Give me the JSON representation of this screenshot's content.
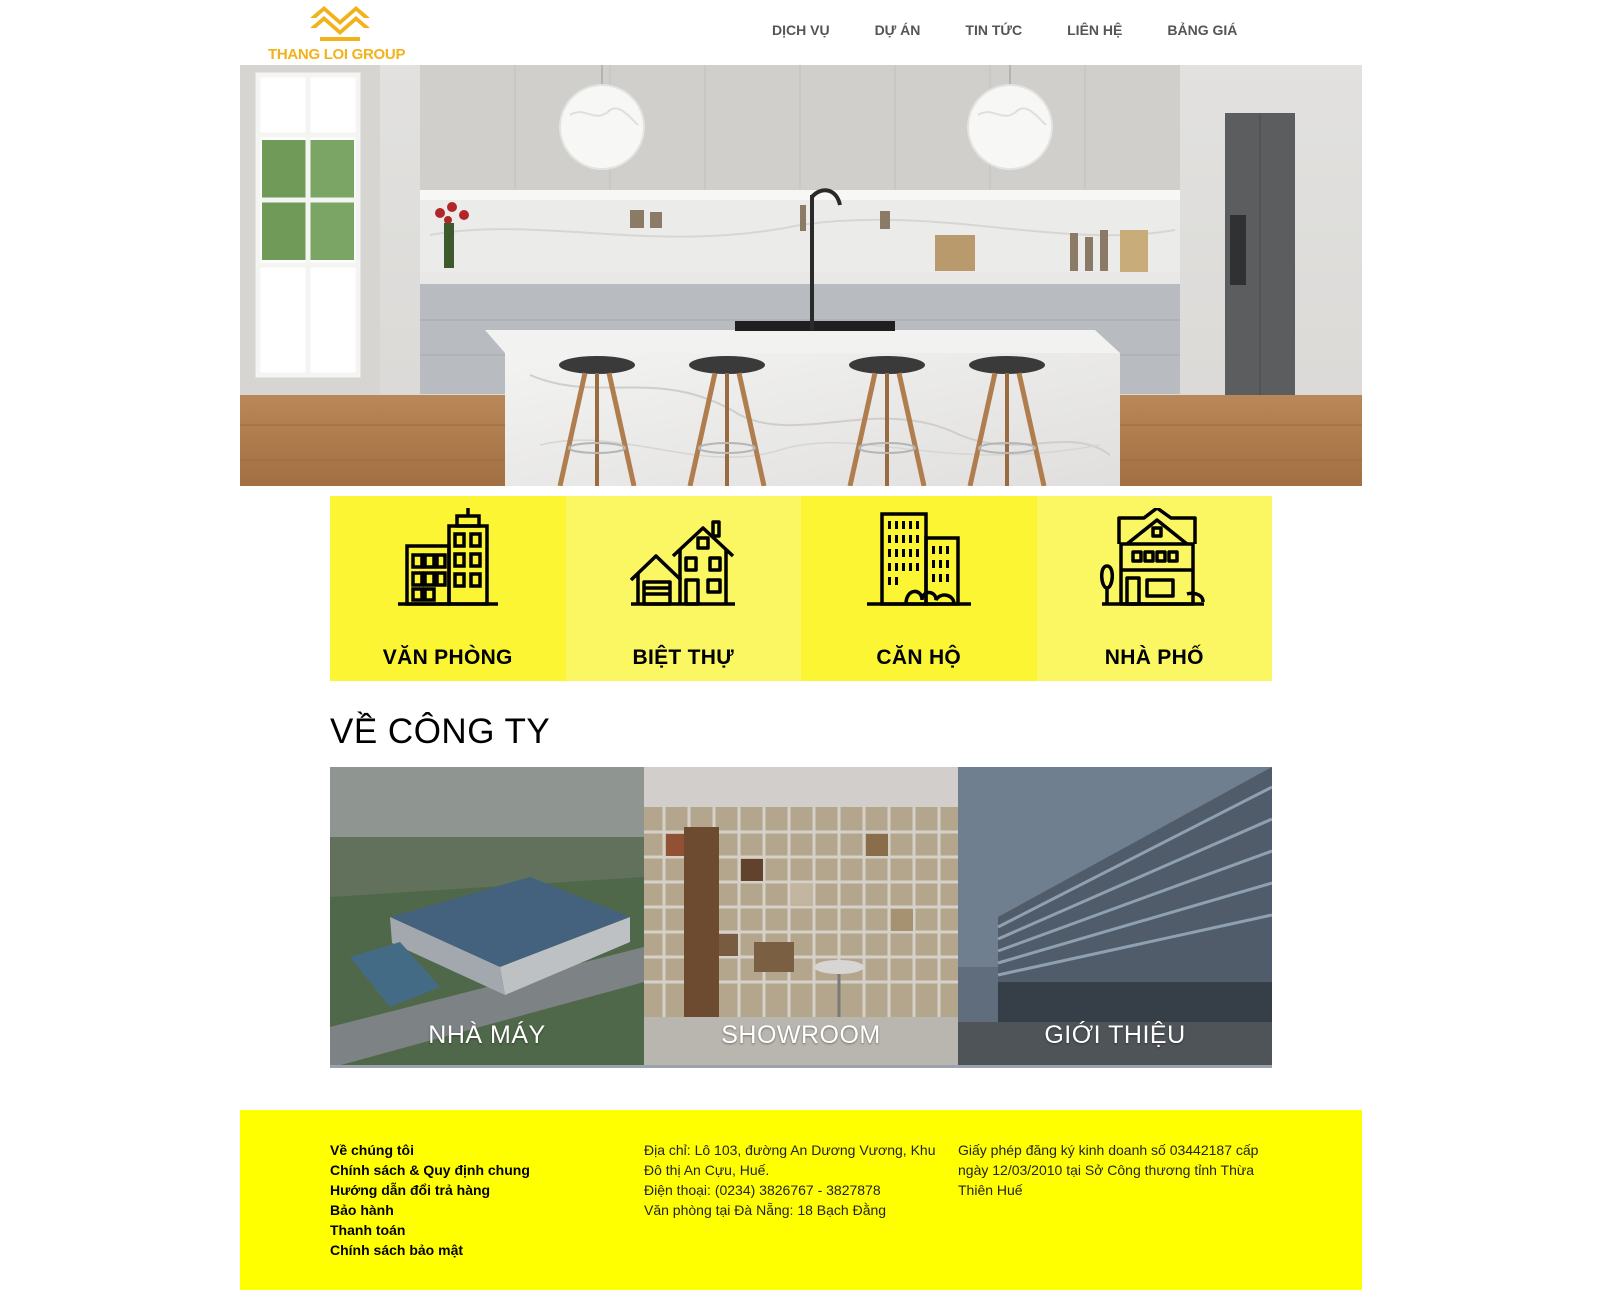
{
  "brand": {
    "logo_text": "THANG LOI GROUP",
    "color": "#f2b21a"
  },
  "nav": [
    {
      "label": "DỊCH VỤ"
    },
    {
      "label": "DỰ ÁN"
    },
    {
      "label": "TIN TỨC"
    },
    {
      "label": "LIÊN HỆ"
    },
    {
      "label": "BẢNG GIÁ"
    }
  ],
  "hero": {
    "icon": "kitchen-photo"
  },
  "categories": [
    {
      "label": "VĂN PHÒNG",
      "icon": "office-building-icon"
    },
    {
      "label": "BIỆT THỰ",
      "icon": "villa-icon"
    },
    {
      "label": "CĂN HỘ",
      "icon": "apartment-icon"
    },
    {
      "label": "NHÀ PHỐ",
      "icon": "townhouse-icon"
    }
  ],
  "about": {
    "title": "VỀ CÔNG TY",
    "cards": [
      {
        "label": "NHÀ MÁY"
      },
      {
        "label": "SHOWROOM"
      },
      {
        "label": "GIỚI THIỆU"
      }
    ]
  },
  "footer": {
    "links": [
      "Về chúng tôi",
      "Chính sách & Quy định chung",
      "Hướng dẫn đổi trả hàng",
      "Bảo hành",
      "Thanh toán",
      "Chính sách bảo mật"
    ],
    "address": "Địa chỉ: Lô 103, đường An Dương Vương, Khu Đô thị An Cựu, Huế.",
    "phone": "Điện thoại: (0234) 3826767 - 3827878",
    "office": "Văn phòng tại Đà Nẵng: 18 Bạch Đằng",
    "license": "Giấy phép đăng ký kinh doanh số 03442187 cấp ngày 12/03/2010 tại Sở Công thương tỉnh Thừa Thiên Huế"
  },
  "colors": {
    "tile_a": "#fcf533",
    "tile_b": "#fbf763",
    "footer_bg": "#ffff00"
  }
}
